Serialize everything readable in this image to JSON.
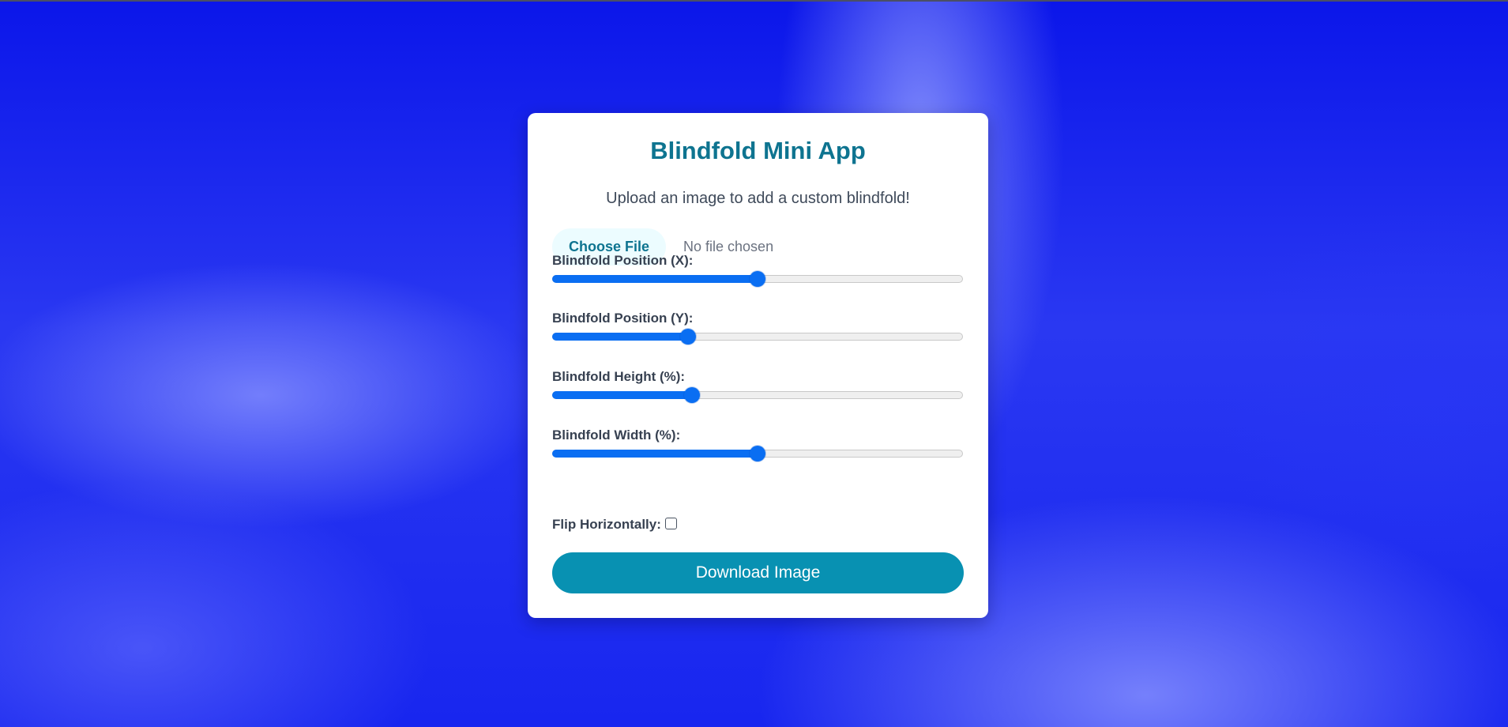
{
  "app": {
    "title": "Blindfold Mini App",
    "subtitle": "Upload an image to add a custom blindfold!"
  },
  "file_input": {
    "button_label": "Choose File",
    "status": "No file chosen"
  },
  "sliders": [
    {
      "label": "Blindfold Position (X):",
      "value_fraction": 0.5
    },
    {
      "label": "Blindfold Position (Y):",
      "value_fraction": 0.33
    },
    {
      "label": "Blindfold Height (%):",
      "value_fraction": 0.34
    },
    {
      "label": "Blindfold Width (%):",
      "value_fraction": 0.5
    }
  ],
  "flip": {
    "label": "Flip Horizontally:",
    "checked": false
  },
  "download": {
    "label": "Download Image"
  },
  "colors": {
    "accent": "#0891b2",
    "title": "#0e7490",
    "slider": "#0a6ef2",
    "background": "#0f1df0"
  }
}
